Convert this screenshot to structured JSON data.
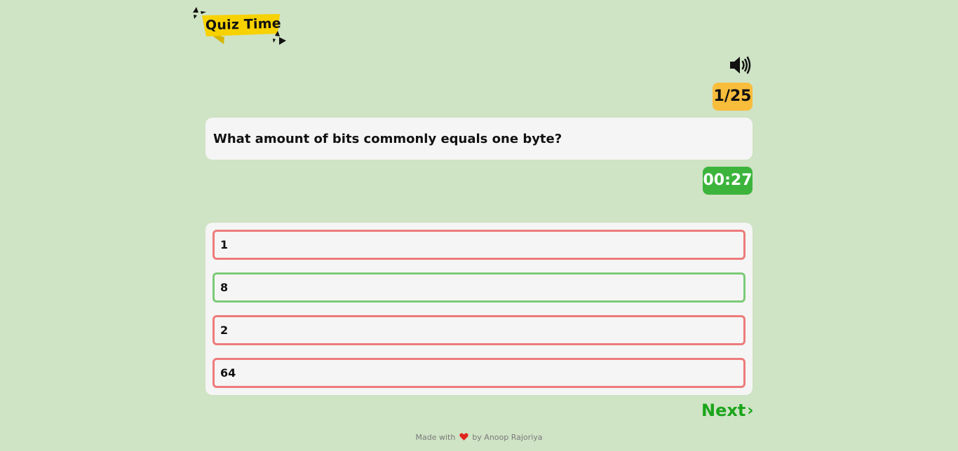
{
  "app": {
    "logo_text": "Quiz Time"
  },
  "quiz": {
    "counter": "1/25",
    "question": "What amount of bits commonly equals one byte?",
    "timer": "00:27",
    "options": [
      {
        "label": "1",
        "state": "wrong"
      },
      {
        "label": "8",
        "state": "correct"
      },
      {
        "label": "2",
        "state": "wrong"
      },
      {
        "label": "64",
        "state": "wrong"
      }
    ],
    "next_label": "Next",
    "next_icon": "chevron-right-icon"
  },
  "footer": {
    "prefix": "Made with",
    "suffix": "by Anoop Rajoriya",
    "heart_icon": "heart-icon"
  },
  "colors": {
    "background": "#cfe3c5",
    "counter_bg": "#f9bd3c",
    "timer_bg": "#3cb43c",
    "correct_border": "#7ccb77",
    "wrong_border": "#ee7b7b",
    "next_text": "#1aa51a",
    "logo_yellow": "#f7d200"
  },
  "icons": {
    "sound": "speaker-icon"
  }
}
